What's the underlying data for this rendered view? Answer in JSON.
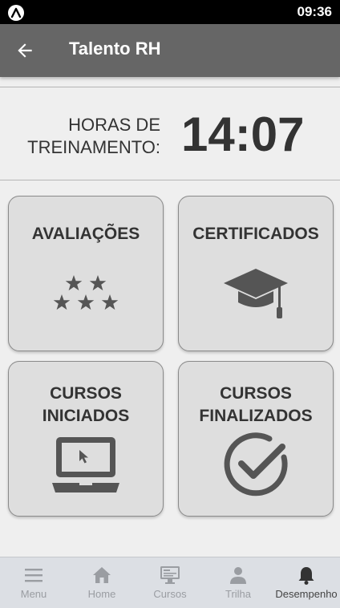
{
  "status_bar": {
    "time": "09:36",
    "app_icon": "a-letter-icon"
  },
  "app_bar": {
    "title": "Talento RH",
    "back_icon": "arrow-left-icon"
  },
  "training": {
    "label_line1": "HORAS DE",
    "label_line2": "TREINAMENTO:",
    "value": "14:07"
  },
  "cards": [
    {
      "line1": "AVALIAÇÕES",
      "line2": "",
      "icon": "stars-icon"
    },
    {
      "line1": "CERTIFICADOS",
      "line2": "",
      "icon": "graduation-cap-icon"
    },
    {
      "line1": "CURSOS",
      "line2": "INICIADOS",
      "icon": "laptop-cursor-icon"
    },
    {
      "line1": "CURSOS",
      "line2": "FINALIZADOS",
      "icon": "check-circle-icon"
    }
  ],
  "bottom_nav": [
    {
      "label": "Menu",
      "icon": "hamburger-menu-icon",
      "active": false
    },
    {
      "label": "Home",
      "icon": "home-icon",
      "active": false
    },
    {
      "label": "Cursos",
      "icon": "monitor-icon",
      "active": false
    },
    {
      "label": "Trilha",
      "icon": "person-icon",
      "active": false
    },
    {
      "label": "Desempenho",
      "icon": "bell-icon",
      "active": true
    }
  ],
  "colors": {
    "app_bar": "#666666",
    "card_bg": "#dedede",
    "icon": "#555555",
    "nav_bg": "#dcdfe4"
  }
}
